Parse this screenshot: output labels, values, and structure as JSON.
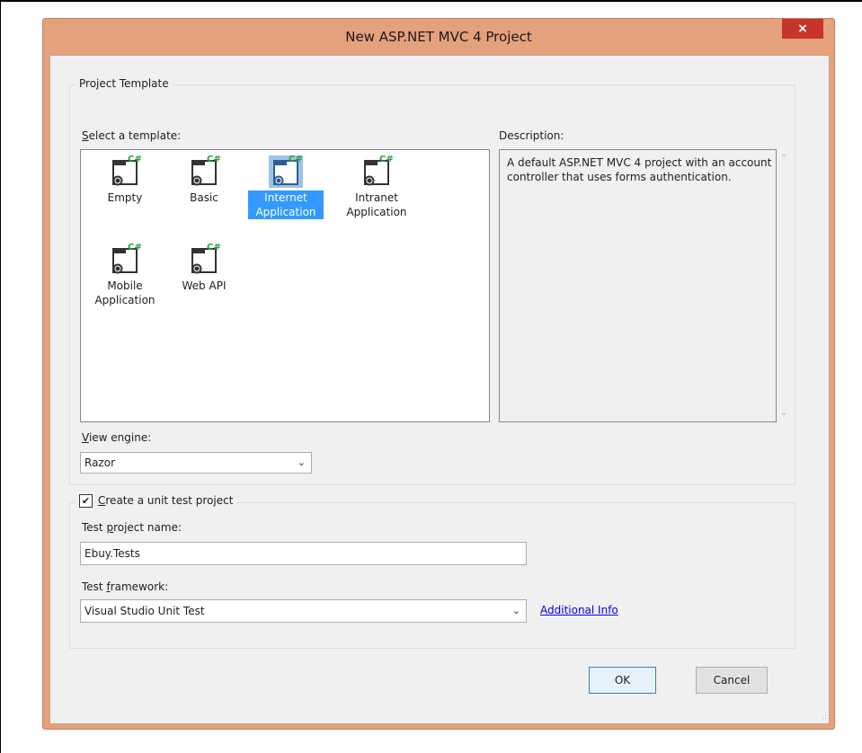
{
  "window": {
    "title": "New ASP.NET MVC 4 Project",
    "close_label": "×"
  },
  "project_template": {
    "group_label": "Project Template",
    "select_label_accel": "S",
    "select_label_rest": "elect a template:",
    "templates": [
      {
        "label": "Empty"
      },
      {
        "label": "Basic"
      },
      {
        "label": "Internet Application",
        "selected": true
      },
      {
        "label": "Intranet Application"
      },
      {
        "label": "Mobile Application"
      },
      {
        "label": "Web API"
      }
    ],
    "description_label": "Description:",
    "description_text": "A default ASP.NET MVC 4 project with an account controller that uses forms authentication.",
    "view_engine_label_accel": "V",
    "view_engine_label_rest": "iew engine:",
    "view_engine_value": "Razor"
  },
  "unit_test": {
    "checkbox_checked": true,
    "checkbox_accel": "C",
    "checkbox_rest": "reate a unit test project",
    "test_name_label_pre": "Test ",
    "test_name_label_accel": "p",
    "test_name_label_post": "roject name:",
    "test_name_value": "Ebuy.Tests",
    "framework_label_pre": "Test ",
    "framework_label_accel": "f",
    "framework_label_post": "ramework:",
    "framework_value": "Visual Studio Unit Test",
    "additional_info_link": "Additional Info"
  },
  "buttons": {
    "ok_label": "OK",
    "cancel_label": "Cancel"
  },
  "icons": {
    "template_icon": "web-project-csharp-icon",
    "close": "close-icon",
    "dropdown": "chevron-down-icon"
  },
  "colors": {
    "title_bar": "#e4a17c",
    "close_button": "#c7352a",
    "selection": "#3399ff",
    "icon_badge": "#2e9e3a"
  }
}
